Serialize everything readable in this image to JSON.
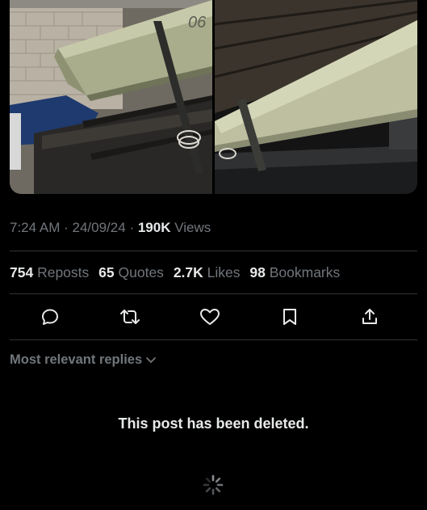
{
  "post": {
    "media_left_marking": "06",
    "timestamp": "7:24 AM",
    "date": "24/09/24",
    "separator": "·",
    "views_count": "190K",
    "views_label": "Views"
  },
  "stats": {
    "reposts_count": "754",
    "reposts_label": "Reposts",
    "quotes_count": "65",
    "quotes_label": "Quotes",
    "likes_count": "2.7K",
    "likes_label": "Likes",
    "bookmarks_count": "98",
    "bookmarks_label": "Bookmarks"
  },
  "actions": [
    "reply-icon",
    "repost-icon",
    "like-icon",
    "bookmark-icon",
    "share-icon"
  ],
  "replies": {
    "sort_label": "Most relevant replies",
    "deleted_message": "This post has been deleted."
  },
  "colors": {
    "background": "#000000",
    "text": "#e7e9ea",
    "muted": "#71767b",
    "divider": "#2f3336"
  }
}
